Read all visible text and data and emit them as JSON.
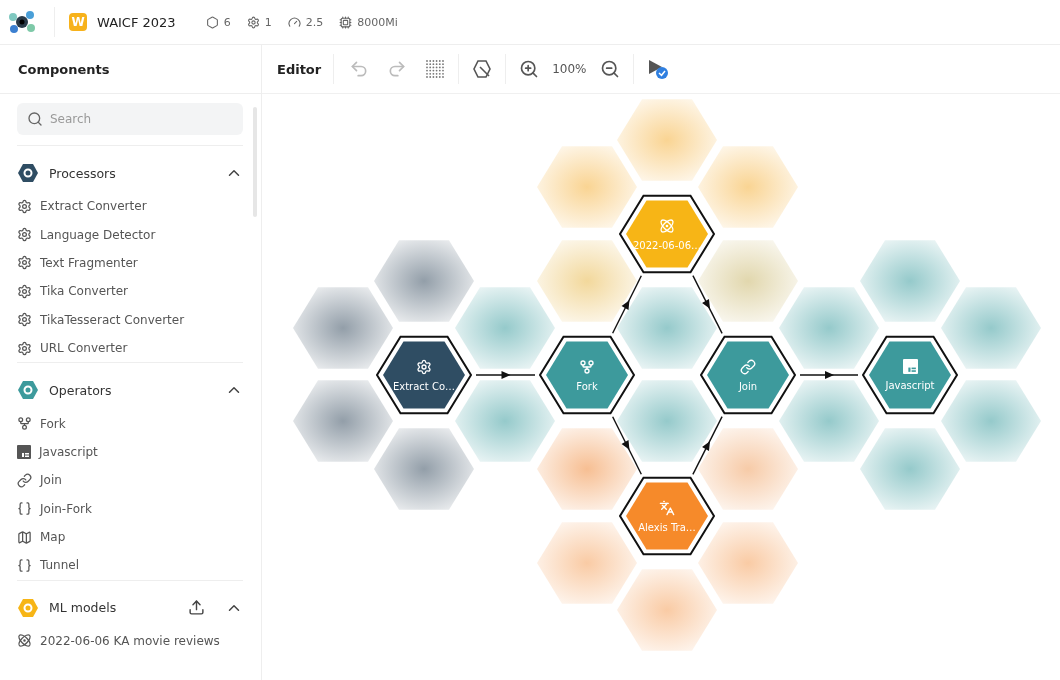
{
  "topbar": {
    "badge": "W",
    "project": "WAICF 2023",
    "stats": [
      {
        "kind": "nodes",
        "value": "6"
      },
      {
        "kind": "processors",
        "value": "1"
      },
      {
        "kind": "speed",
        "value": "2.5"
      },
      {
        "kind": "memory",
        "value": "8000Mi"
      }
    ]
  },
  "sidebar": {
    "title": "Components",
    "search": {
      "placeholder": "Search"
    },
    "sections": [
      {
        "title": "Processors",
        "kind": "processor",
        "expanded": true,
        "upload": false,
        "items": [
          {
            "label": "Extract Converter",
            "kind": "gear"
          },
          {
            "label": "Language Detector",
            "kind": "gear"
          },
          {
            "label": "Text Fragmenter",
            "kind": "gear"
          },
          {
            "label": "Tika Converter",
            "kind": "gear"
          },
          {
            "label": "TikaTesseract Converter",
            "kind": "gear"
          },
          {
            "label": "URL Converter",
            "kind": "gear"
          }
        ]
      },
      {
        "title": "Operators",
        "kind": "operator",
        "expanded": true,
        "upload": false,
        "items": [
          {
            "label": "Fork",
            "kind": "fork"
          },
          {
            "label": "Javascript",
            "kind": "javascript"
          },
          {
            "label": "Join",
            "kind": "join"
          },
          {
            "label": "Join-Fork",
            "kind": "braces"
          },
          {
            "label": "Map",
            "kind": "map"
          },
          {
            "label": "Tunnel",
            "kind": "braces"
          }
        ]
      },
      {
        "title": "ML models",
        "kind": "model",
        "expanded": true,
        "upload": true,
        "items": [
          {
            "label": "2022-06-06 KA movie reviews",
            "kind": "model"
          }
        ]
      }
    ]
  },
  "editor": {
    "title": "Editor",
    "zoom": "100%",
    "undo_disabled": true,
    "redo_disabled": true
  },
  "canvas": {
    "nodes": [
      {
        "label": "Extract Co…",
        "kind": "processor"
      },
      {
        "label": "Fork",
        "kind": "fork"
      },
      {
        "label": "2022-06-06…",
        "kind": "model"
      },
      {
        "label": "Alexis Tra…",
        "kind": "translator"
      },
      {
        "label": "Join",
        "kind": "join"
      },
      {
        "label": "Javascript",
        "kind": "javascript"
      }
    ]
  }
}
